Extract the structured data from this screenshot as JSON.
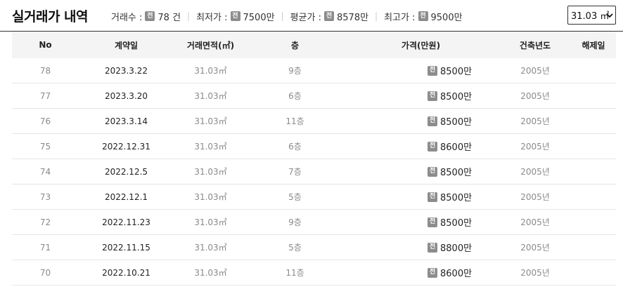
{
  "header": {
    "title": "실거래가 내역",
    "stats": [
      {
        "label": "거래수 :",
        "badge": "전",
        "value": "78 건"
      },
      {
        "label": "최저가 :",
        "badge": "전",
        "value": "7500만"
      },
      {
        "label": "평균가 :",
        "badge": "전",
        "value": "8578만"
      },
      {
        "label": "최고가 :",
        "badge": "전",
        "value": "9500만"
      }
    ],
    "area_select": {
      "value": "31.03 ㎡"
    }
  },
  "table": {
    "columns": [
      "No",
      "계약일",
      "거래면적(㎡)",
      "층",
      "가격(만원)",
      "건축년도",
      "해제일"
    ],
    "rows": [
      {
        "no": "78",
        "date": "2023.3.22",
        "area": "31.03㎡",
        "floor": "9층",
        "badge": "전",
        "price": "8500만",
        "year": "2005년",
        "cancel": ""
      },
      {
        "no": "77",
        "date": "2023.3.20",
        "area": "31.03㎡",
        "floor": "6층",
        "badge": "전",
        "price": "8500만",
        "year": "2005년",
        "cancel": ""
      },
      {
        "no": "76",
        "date": "2023.3.14",
        "area": "31.03㎡",
        "floor": "11층",
        "badge": "전",
        "price": "8500만",
        "year": "2005년",
        "cancel": ""
      },
      {
        "no": "75",
        "date": "2022.12.31",
        "area": "31.03㎡",
        "floor": "6층",
        "badge": "전",
        "price": "8600만",
        "year": "2005년",
        "cancel": ""
      },
      {
        "no": "74",
        "date": "2022.12.5",
        "area": "31.03㎡",
        "floor": "7층",
        "badge": "전",
        "price": "8500만",
        "year": "2005년",
        "cancel": ""
      },
      {
        "no": "73",
        "date": "2022.12.1",
        "area": "31.03㎡",
        "floor": "5층",
        "badge": "전",
        "price": "8500만",
        "year": "2005년",
        "cancel": ""
      },
      {
        "no": "72",
        "date": "2022.11.23",
        "area": "31.03㎡",
        "floor": "9층",
        "badge": "전",
        "price": "8500만",
        "year": "2005년",
        "cancel": ""
      },
      {
        "no": "71",
        "date": "2022.11.15",
        "area": "31.03㎡",
        "floor": "5층",
        "badge": "전",
        "price": "8800만",
        "year": "2005년",
        "cancel": ""
      },
      {
        "no": "70",
        "date": "2022.10.21",
        "area": "31.03㎡",
        "floor": "11층",
        "badge": "전",
        "price": "8600만",
        "year": "2005년",
        "cancel": ""
      }
    ]
  }
}
